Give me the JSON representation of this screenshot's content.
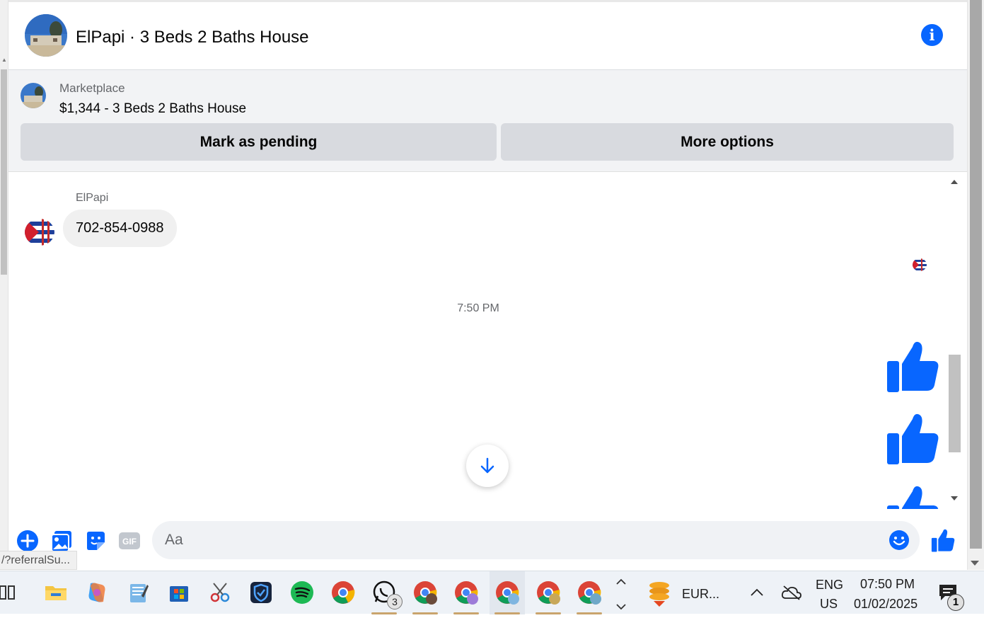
{
  "header": {
    "title": "ElPapi · 3 Beds 2 Baths House",
    "info_icon": "info-icon"
  },
  "listing": {
    "label": "Marketplace",
    "price_title": "$1,344 - 3 Beds 2 Baths House",
    "mark_pending": "Mark as pending",
    "more_options": "More options"
  },
  "messages": {
    "sender_name": "ElPapi",
    "text": "702-854-0988",
    "timestamp": "7:50 PM",
    "sent_likes": 3
  },
  "composer": {
    "placeholder": "Aa",
    "gif_label": "GIF",
    "icons": [
      "add-icon",
      "photo-icon",
      "sticker-icon",
      "gif-icon",
      "emoji-icon",
      "like-icon"
    ]
  },
  "status_tooltip": "/?referralSu...",
  "taskbar": {
    "whatsapp_badge": "3",
    "tray_app_label": "EUR...",
    "language_top": "ENG",
    "language_bottom": "US",
    "time": "07:50 PM",
    "date": "01/02/2025",
    "notification_count": "1"
  },
  "colors": {
    "accent": "#0866ff",
    "bubble": "#f0f0f0",
    "listing_bg": "#f2f3f5",
    "button_bg": "#d8dadf"
  }
}
